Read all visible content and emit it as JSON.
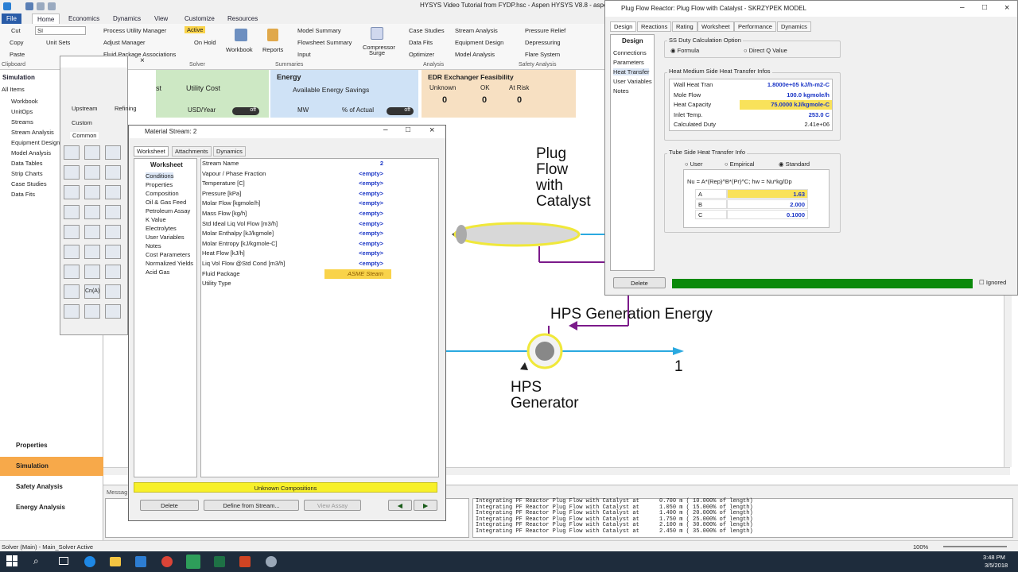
{
  "window": {
    "title": "HYSYS Video Tutorial from FYDP.hsc - Aspen HYSYS V8.8 - aspen"
  },
  "ribbon": {
    "tabs": [
      "File",
      "Home",
      "Economics",
      "Dynamics",
      "View",
      "Customize",
      "Resources"
    ],
    "clipboard": {
      "cut": "Cut",
      "copy": "Copy",
      "paste": "Paste",
      "group": "Clipboard"
    },
    "units": {
      "value": "SI",
      "unit_sets": "Unit Sets"
    },
    "navigate": {
      "process_utility": "Process Utility Manager",
      "adjust": "Adjust Manager",
      "fluid_pkg": "Fluid Package Associations"
    },
    "solver": {
      "active": "Active",
      "on_hold": "On Hold",
      "group": "Solver"
    },
    "summaries": {
      "workbook": "Workbook",
      "reports": "Reports",
      "model_summary": "Model Summary",
      "flowsheet_summary": "Flowsheet Summary",
      "input": "Input",
      "group": "Summaries"
    },
    "analysis": {
      "compressor": "Compressor Surge",
      "case_studies": "Case Studies",
      "data_fits": "Data Fits",
      "optimizer": "Optimizer",
      "stream_analysis": "Stream Analysis",
      "equipment_design": "Equipment Design",
      "model_analysis": "Model Analysis",
      "group": "Analysis"
    },
    "safety": {
      "pressure_relief": "Pressure Relief",
      "depressuring": "Depressuring",
      "flare": "Flare System",
      "group": "Safety Analysis"
    }
  },
  "nav": {
    "header": "Simulation",
    "filter": "All Items",
    "items": [
      "Workbook",
      "UnitOps",
      "Streams",
      "Stream Analysis",
      "Equipment Design",
      "Model Analysis",
      "Data Tables",
      "Strip Charts",
      "Case Studies",
      "Data Fits"
    ],
    "bottom": [
      "Properties",
      "Simulation",
      "Safety Analysis",
      "Energy Analysis"
    ]
  },
  "dash": {
    "cost": {
      "title": "Utility Cost",
      "label1": "st",
      "unit": "USD/Year",
      "toggle": "off"
    },
    "energy": {
      "title": "Energy",
      "sub": "Available Energy Savings",
      "unit1": "MW",
      "unit2": "% of Actual",
      "toggle": "off"
    },
    "edr": {
      "title": "EDR Exchanger Feasibility",
      "cols": [
        "Unknown",
        "OK",
        "At Risk"
      ],
      "vals": [
        "0",
        "0",
        "0"
      ]
    }
  },
  "palette": {
    "tabs": [
      "Upstream",
      "Refining",
      "Custom",
      "Dynamics",
      "Common",
      "Colu"
    ],
    "cn": "Cn(A)"
  },
  "flowsheet": {
    "reactor_label": "Plug\nFlow\nwith\nCatalyst",
    "energy_label": "HPS Generation Energy",
    "gen_label": "HPS\nGenerator",
    "stream1": "1"
  },
  "material_stream": {
    "title": "Material Stream: 2",
    "tabs": [
      "Worksheet",
      "Attachments",
      "Dynamics"
    ],
    "nav_header": "Worksheet",
    "nav": [
      "Conditions",
      "Properties",
      "Composition",
      "Oil & Gas Feed",
      "Petroleum Assay",
      "K Value",
      "Electrolytes",
      "User Variables",
      "Notes",
      "Cost Parameters",
      "Normalized Yields",
      "Acid Gas"
    ],
    "rows": [
      {
        "label": "Stream Name",
        "value": "2"
      },
      {
        "label": "Vapour / Phase Fraction",
        "value": "<empty>"
      },
      {
        "label": "Temperature [C]",
        "value": "<empty>"
      },
      {
        "label": "Pressure [kPa]",
        "value": "<empty>"
      },
      {
        "label": "Molar Flow [kgmole/h]",
        "value": "<empty>"
      },
      {
        "label": "Mass Flow [kg/h]",
        "value": "<empty>"
      },
      {
        "label": "Std Ideal Liq Vol Flow [m3/h]",
        "value": "<empty>"
      },
      {
        "label": "Molar Enthalpy [kJ/kgmole]",
        "value": "<empty>"
      },
      {
        "label": "Molar Entropy [kJ/kgmole-C]",
        "value": "<empty>"
      },
      {
        "label": "Heat Flow [kJ/h]",
        "value": "<empty>"
      },
      {
        "label": "Liq Vol Flow @Std Cond [m3/h]",
        "value": "<empty>"
      },
      {
        "label": "Fluid Package",
        "value": "ASME Steam"
      },
      {
        "label": "Utility Type",
        "value": ""
      }
    ],
    "status": "Unknown Compositions",
    "buttons": {
      "delete": "Delete",
      "define": "Define from Stream...",
      "view_assay": "View Assay"
    }
  },
  "pfr": {
    "title": "Plug Flow Reactor: Plug Flow with Catalyst - SKRZYPEK MODEL",
    "tabs": [
      "Design",
      "Reactions",
      "Rating",
      "Worksheet",
      "Performance",
      "Dynamics"
    ],
    "nav_header": "Design",
    "nav": [
      "Connections",
      "Parameters",
      "Heat Transfer",
      "User Variables",
      "Notes"
    ],
    "ss_duty": {
      "caption": "SS Duty Calculation Option",
      "opt1": "Formula",
      "opt2": "Direct Q Value"
    },
    "heat_medium": {
      "caption": "Heat Medium Side Heat Transfer Infos",
      "rows": [
        [
          "Wall Heat Tran",
          "1.8000e+05 kJ/h-m2-C"
        ],
        [
          "Mole Flow",
          "100.0 kgmole/h"
        ],
        [
          "Heat Capacity",
          "75.0000 kJ/kgmole-C"
        ],
        [
          "Inlet Temp.",
          "253.0 C"
        ],
        [
          "Calculated Duty",
          "2.41e+06"
        ]
      ]
    },
    "tube_side": {
      "caption": "Tube Side Heat Transfer Info",
      "opts": [
        "User",
        "Empirical",
        "Standard"
      ],
      "formula": "Nu = A*(Rep)^B*(Pr)^C; hw = Nu*kg/Dp",
      "rows": [
        [
          "A",
          "1.63"
        ],
        [
          "B",
          "2.000"
        ],
        [
          "C",
          "0.1000"
        ]
      ]
    },
    "delete": "Delete",
    "ok": "OK",
    "ignored": "Ignored"
  },
  "messages": {
    "label": "Messag",
    "lines": [
      "Integrating PF Reactor Plug Flow with Catalyst at      0.700 m ( 10.000% of length)",
      "Integrating PF Reactor Plug Flow with Catalyst at      1.050 m ( 15.000% of length)",
      "Integrating PF Reactor Plug Flow with Catalyst at      1.400 m ( 20.000% of length)",
      "Integrating PF Reactor Plug Flow with Catalyst at      1.750 m ( 25.000% of length)",
      "Integrating PF Reactor Plug Flow with Catalyst at      2.100 m ( 30.000% of length)",
      "Integrating PF Reactor Plug Flow with Catalyst at      2.450 m ( 35.000% of length)"
    ]
  },
  "status": {
    "solver": "Solver (Main) - Main_Solver Active",
    "zoom": "100%"
  },
  "taskbar": {
    "time": "3:48 PM",
    "date": "3/5/2018"
  },
  "colors": {
    "accent": "#1a35c6",
    "yellow": "#f7f02a",
    "green": "#0a8a0a",
    "cost": "#cde8c4",
    "energy": "#cfe2f6",
    "edr": "#f7e0c2"
  }
}
